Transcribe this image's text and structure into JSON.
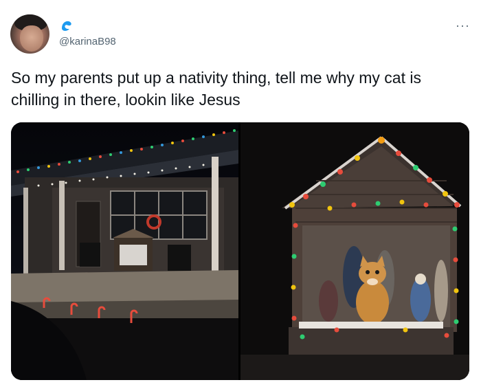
{
  "user": {
    "handle": "@karinaB98"
  },
  "tweet": {
    "text": "So my parents put up a nativity thing, tell me why my cat is chilling in there, lookin like Jesus"
  },
  "menu": {
    "more_label": "···"
  },
  "colors": {
    "badge": "#1d9bf0",
    "handle": "#536471",
    "text": "#0f1419"
  },
  "media": {
    "images": [
      {
        "icon": "house-with-christmas-lights-photo"
      },
      {
        "icon": "cat-in-nativity-scene-photo"
      }
    ]
  }
}
